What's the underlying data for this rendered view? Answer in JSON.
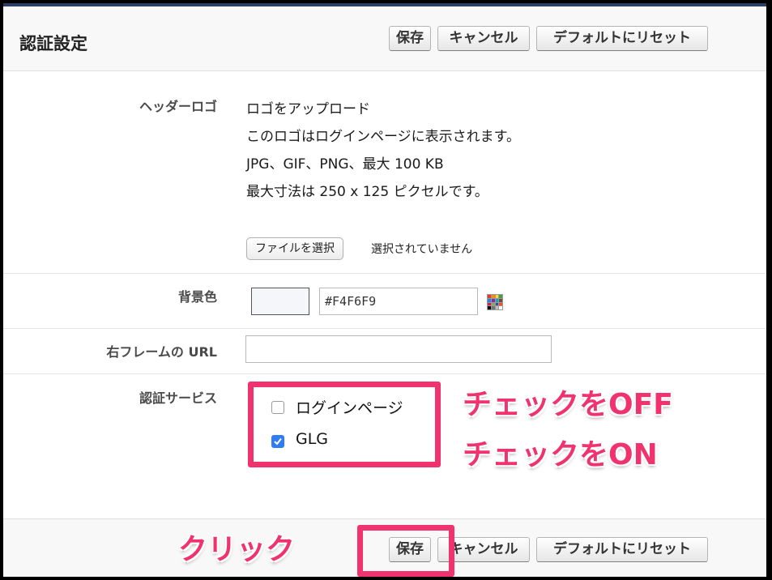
{
  "page": {
    "title": "認証設定",
    "buttons": {
      "save": "保存",
      "cancel": "キャンセル",
      "reset": "デフォルトにリセット"
    }
  },
  "fields": {
    "header_logo": {
      "label": "ヘッダーロゴ",
      "lines": [
        "ロゴをアップロード",
        "このロゴはログインページに表示されます。",
        "JPG、GIF、PNG、最大 100 KB",
        "最大寸法は 250 x 125 ピクセルです。"
      ],
      "file_button": "ファイルを選択",
      "file_status": "選択されていません"
    },
    "background_color": {
      "label": "背景色",
      "value": "#F4F6F9",
      "swatch_color": "#F4F6F9"
    },
    "right_frame_url": {
      "label": "右フレームの URL",
      "value": ""
    },
    "auth_services": {
      "label": "認証サービス",
      "options": [
        {
          "label": "ログインページ",
          "checked": false
        },
        {
          "label": "GLG",
          "checked": true
        }
      ]
    }
  },
  "annotations": {
    "uncheck": "チェックをOFF",
    "check": "チェックをON",
    "click": "クリック"
  },
  "colors": {
    "accent": "#f0336f",
    "checkbox": "#2f7cf6",
    "header_rule": "#2c3e63"
  },
  "icons": {
    "color_picker": "color-palette-icon",
    "checkmark": "checkmark-icon"
  }
}
